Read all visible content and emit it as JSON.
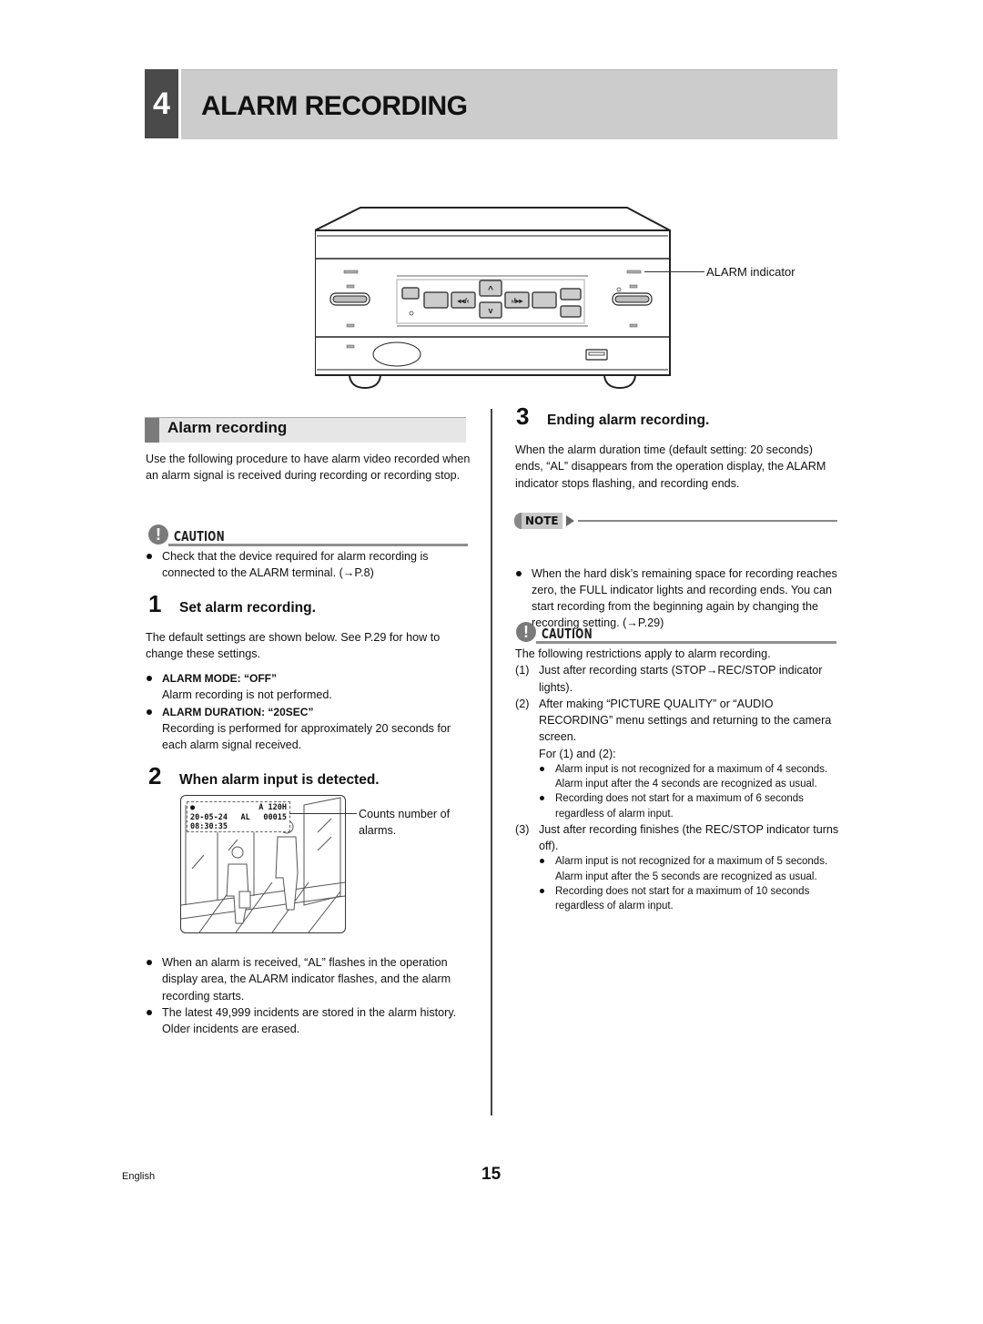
{
  "header": {
    "chapter_number": "4",
    "title": "ALARM RECORDING"
  },
  "device_figure": {
    "callout": "ALARM indicator",
    "button_glyphs": {
      "rewind": "◂◂/‹",
      "forward": "›/▸▸",
      "up": "^",
      "down": "v",
      "play_stop": "▶/■",
      "pause": "❚❚"
    }
  },
  "left": {
    "section_title": "Alarm recording",
    "intro": "Use the following procedure to have alarm video recorded when an alarm signal is received during recording or recording stop.",
    "caution1": {
      "icon": "exclamation-icon",
      "label": "CAUTION",
      "items": [
        "Check that the device required for alarm recording is connected to the ALARM terminal. (→P.8)"
      ]
    },
    "step1": {
      "number": "1",
      "title": "Set alarm recording.",
      "desc": "The default settings are shown below. See P.29 for how to change these settings.",
      "settings": [
        {
          "name": "ALARM MODE: “OFF”",
          "desc": "Alarm recording is not performed."
        },
        {
          "name": "ALARM DURATION: “20SEC”",
          "desc": "Recording is performed for approximately 20 seconds for each alarm signal received."
        }
      ]
    },
    "step2": {
      "number": "2",
      "title": "When alarm input is detected.",
      "screen": {
        "rec_dot": "●",
        "mode": "A",
        "hours": "120H",
        "date": "20-05-24",
        "time": "08:30:35",
        "alarm_flag": "AL",
        "count": "00015"
      },
      "callout": "Counts number of alarms.",
      "bullets": [
        "When an alarm is received, “AL” flashes in the operation display area, the ALARM indicator flashes, and the alarm recording starts.",
        "The latest 49,999 incidents are stored in the alarm history. Older incidents are erased."
      ]
    }
  },
  "right": {
    "step3": {
      "number": "3",
      "title": "Ending alarm recording.",
      "desc": "When the alarm duration time (default setting: 20 seconds) ends, “AL” disappears from the operation display, the ALARM indicator stops flashing, and recording ends."
    },
    "note": {
      "label": "NOTE",
      "items": [
        "When the hard disk’s remaining space for recording reaches zero, the FULL indicator lights and recording ends. You can start recording from the beginning again by changing the recording setting. (→P.29)"
      ]
    },
    "caution2": {
      "label": "CAUTION",
      "intro": "The following restrictions apply to alarm recording.",
      "items": [
        {
          "n": "(1)",
          "text": "Just after recording starts (STOP→REC/STOP indicator lights)."
        },
        {
          "n": "(2)",
          "text": "After making “PICTURE QUALITY” or “AUDIO RECORDING” menu settings and returning to the camera screen.",
          "sub_intro": "For (1) and (2):",
          "subs": [
            "Alarm input is not recognized for a maximum of 4 seconds. Alarm input after the 4 seconds are recognized as usual.",
            "Recording does not start for a maximum of 6 seconds regardless of alarm input."
          ]
        },
        {
          "n": "(3)",
          "text": "Just after recording finishes (the REC/STOP indicator turns off).",
          "subs": [
            "Alarm input is not recognized for a maximum of 5 seconds. Alarm input after the 5 seconds are recognized as usual.",
            "Recording does not start for a maximum of 10 seconds regardless of alarm input."
          ]
        }
      ]
    }
  },
  "footer": {
    "language": "English",
    "page_number": "15"
  }
}
